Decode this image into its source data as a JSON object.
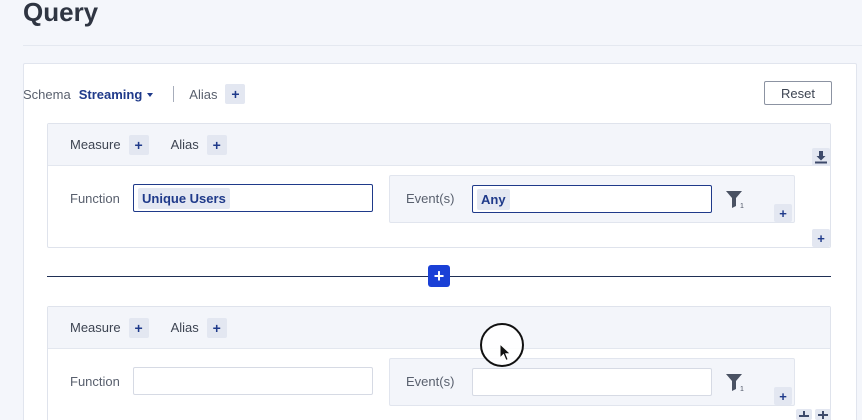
{
  "page": {
    "title": "Query"
  },
  "schema": {
    "label": "Schema",
    "value": "Streaming",
    "alias_label": "Alias",
    "add_alias_symbol": "+"
  },
  "reset_label": "Reset",
  "measures": [
    {
      "measure_label": "Measure",
      "alias_label": "Alias",
      "function_label": "Function",
      "function_value": "Unique Users",
      "events_label": "Event(s)",
      "events_value": "Any",
      "filter_count": "1"
    },
    {
      "measure_label": "Measure",
      "alias_label": "Alias",
      "function_label": "Function",
      "function_value": "",
      "events_label": "Event(s)",
      "events_value": "",
      "filter_count": "1"
    }
  ],
  "plus_symbol": "+",
  "icons": {
    "download": "download-icon",
    "filter": "filter-icon",
    "add": "plus-icon",
    "cursor": "mouse-cursor"
  },
  "colors": {
    "accent": "#1f3a8a",
    "primary_button": "#1a40d6",
    "chip_bg": "#e4e8f2",
    "panel_bg": "#f3f5fa"
  }
}
